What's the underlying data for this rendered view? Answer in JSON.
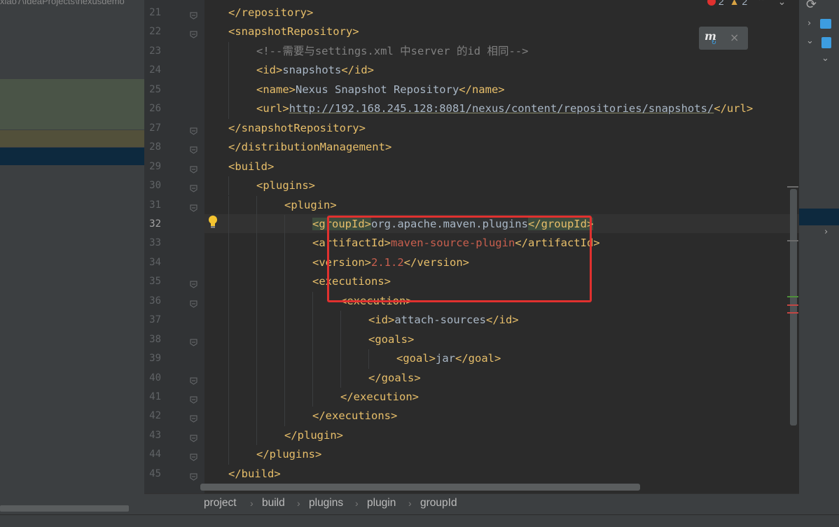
{
  "left_panel": {
    "path_text": "xiao7\\IdeaProjects\\nexusdemo"
  },
  "status": {
    "errors": "2",
    "warnings": "2"
  },
  "lines": [
    {
      "num": "21",
      "indent": 1,
      "fold": true,
      "parts": [
        {
          "c": "t",
          "s": "</repository>"
        }
      ]
    },
    {
      "num": "22",
      "indent": 1,
      "fold": true,
      "parts": [
        {
          "c": "t",
          "s": "<snapshotRepository>"
        }
      ]
    },
    {
      "num": "23",
      "indent": 2,
      "parts": [
        {
          "c": "cm",
          "s": "<!--需要与settings.xml 中server 的id 相同-->"
        }
      ]
    },
    {
      "num": "24",
      "indent": 2,
      "parts": [
        {
          "c": "t",
          "s": "<id>"
        },
        {
          "c": "x",
          "s": "snapshots"
        },
        {
          "c": "t",
          "s": "</id>"
        }
      ]
    },
    {
      "num": "25",
      "indent": 2,
      "parts": [
        {
          "c": "t",
          "s": "<name>"
        },
        {
          "c": "x",
          "s": "Nexus Snapshot Repository"
        },
        {
          "c": "t",
          "s": "</name>"
        }
      ]
    },
    {
      "num": "26",
      "indent": 2,
      "parts": [
        {
          "c": "t",
          "s": "<url>"
        },
        {
          "c": "u",
          "s": "http://192.168.245.128:8081/nexus/content/repositories/snapshots/"
        },
        {
          "c": "t",
          "s": "</url>"
        }
      ]
    },
    {
      "num": "27",
      "indent": 1,
      "fold": true,
      "parts": [
        {
          "c": "t",
          "s": "</snapshotRepository>"
        }
      ]
    },
    {
      "num": "28",
      "indent": 1,
      "fold": true,
      "parts": [
        {
          "c": "t",
          "s": "</distributionManagement>"
        }
      ]
    },
    {
      "num": "29",
      "indent": 1,
      "fold": true,
      "parts": [
        {
          "c": "t",
          "s": "<build>"
        }
      ]
    },
    {
      "num": "30",
      "indent": 2,
      "fold": true,
      "parts": [
        {
          "c": "t",
          "s": "<plugins>"
        }
      ]
    },
    {
      "num": "31",
      "indent": 3,
      "fold": true,
      "parts": [
        {
          "c": "t",
          "s": "<plugin>"
        }
      ]
    },
    {
      "num": "32",
      "indent": 4,
      "current": true,
      "parts": [
        {
          "c": "t hl",
          "s": "<groupId>"
        },
        {
          "c": "x",
          "s": "org.apache.maven.plugins"
        },
        {
          "c": "t hl",
          "s": "</groupId>"
        }
      ]
    },
    {
      "num": "33",
      "indent": 4,
      "parts": [
        {
          "c": "t",
          "s": "<artifactId>"
        },
        {
          "c": "s",
          "s": "maven-source-plugin"
        },
        {
          "c": "t",
          "s": "</artifactId>"
        }
      ]
    },
    {
      "num": "34",
      "indent": 4,
      "parts": [
        {
          "c": "t",
          "s": "<version>"
        },
        {
          "c": "s",
          "s": "2.1.2"
        },
        {
          "c": "t",
          "s": "</version>"
        }
      ]
    },
    {
      "num": "35",
      "indent": 4,
      "fold": true,
      "parts": [
        {
          "c": "t",
          "s": "<executions>"
        }
      ]
    },
    {
      "num": "36",
      "indent": 5,
      "fold": true,
      "parts": [
        {
          "c": "t",
          "s": "<execution>"
        }
      ]
    },
    {
      "num": "37",
      "indent": 6,
      "parts": [
        {
          "c": "t",
          "s": "<id>"
        },
        {
          "c": "x",
          "s": "attach-sources"
        },
        {
          "c": "t",
          "s": "</id>"
        }
      ]
    },
    {
      "num": "38",
      "indent": 6,
      "fold": true,
      "parts": [
        {
          "c": "t",
          "s": "<goals>"
        }
      ]
    },
    {
      "num": "39",
      "indent": 7,
      "parts": [
        {
          "c": "t",
          "s": "<goal>"
        },
        {
          "c": "x",
          "s": "jar"
        },
        {
          "c": "t",
          "s": "</goal>"
        }
      ]
    },
    {
      "num": "40",
      "indent": 6,
      "fold": true,
      "parts": [
        {
          "c": "t",
          "s": "</goals>"
        }
      ]
    },
    {
      "num": "41",
      "indent": 5,
      "fold": true,
      "parts": [
        {
          "c": "t",
          "s": "</execution>"
        }
      ]
    },
    {
      "num": "42",
      "indent": 4,
      "fold": true,
      "parts": [
        {
          "c": "t",
          "s": "</executions>"
        }
      ]
    },
    {
      "num": "43",
      "indent": 3,
      "fold": true,
      "parts": [
        {
          "c": "t",
          "s": "</plugin>"
        }
      ]
    },
    {
      "num": "44",
      "indent": 2,
      "fold": true,
      "parts": [
        {
          "c": "t",
          "s": "</plugins>"
        }
      ]
    },
    {
      "num": "45",
      "indent": 1,
      "fold": true,
      "parts": [
        {
          "c": "t",
          "s": "</build>"
        }
      ]
    }
  ],
  "breadcrumb": [
    "project",
    "build",
    "plugins",
    "plugin",
    "groupId"
  ],
  "icons": {
    "bulb": "lightbulb-icon",
    "maven": "maven-reload-icon",
    "close": "close-icon"
  }
}
